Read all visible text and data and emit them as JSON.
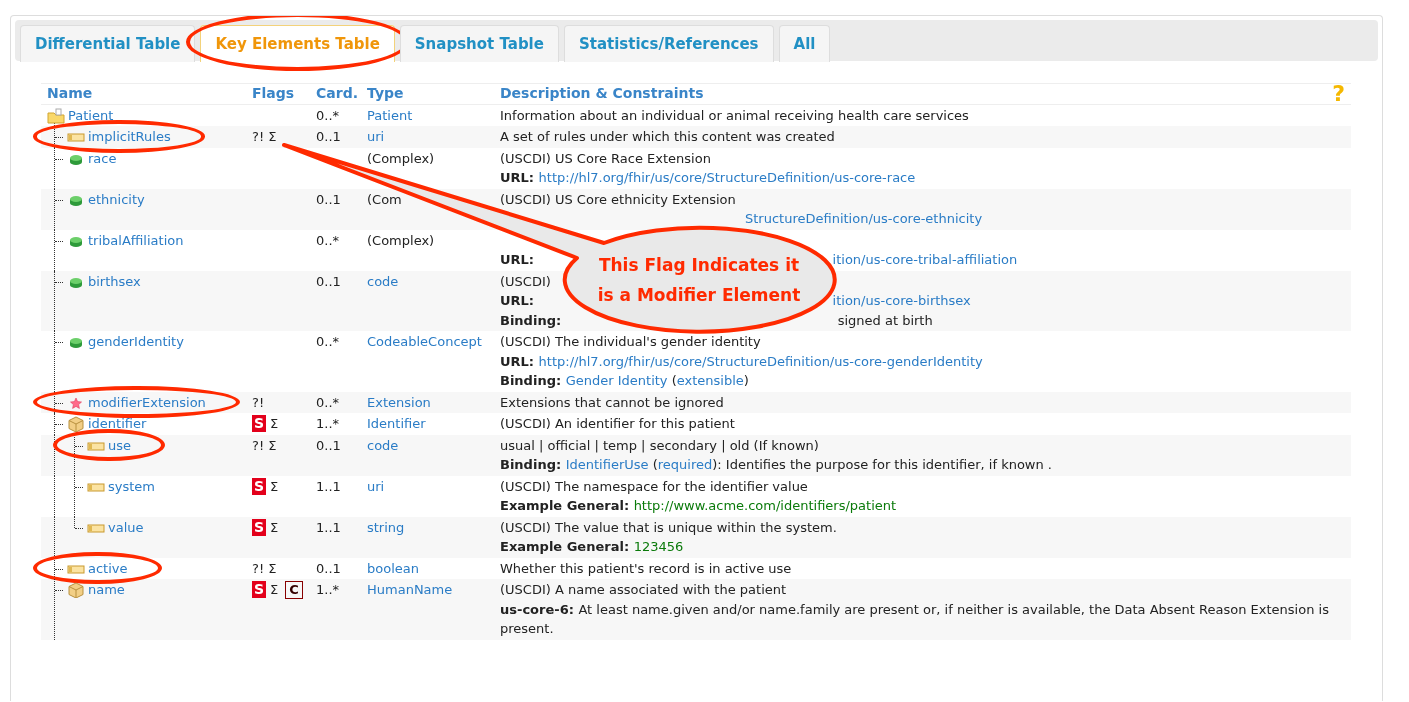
{
  "tabs": [
    {
      "label": "Differential Table",
      "selected": false,
      "circled": false
    },
    {
      "label": "Key Elements Table",
      "selected": true,
      "circled": true
    },
    {
      "label": "Snapshot Table",
      "selected": false,
      "circled": false
    },
    {
      "label": "Statistics/References",
      "selected": false,
      "circled": false
    },
    {
      "label": "All",
      "selected": false,
      "circled": false
    }
  ],
  "table": {
    "columns": [
      "Name",
      "Flags",
      "Card.",
      "Type",
      "Description & Constraints"
    ],
    "help": "?",
    "tree": [
      {
        "name": "Patient",
        "kind": "resource",
        "circled": false,
        "card": "0..*",
        "type": {
          "text": "Patient",
          "kind": "link"
        },
        "description": [
          [
            {
              "kind": "text",
              "text": "Information about an individual or animal receiving health care services"
            }
          ]
        ],
        "children": [
          {
            "name": "implicitRules",
            "kind": "element",
            "circled": true,
            "card": "0..1",
            "type": {
              "text": "uri",
              "kind": "link"
            },
            "flags": [
              {
                "kind": "modifier",
                "text": "?!"
              },
              {
                "kind": "summary",
                "text": "Σ"
              }
            ],
            "description": [
              [
                {
                  "kind": "text",
                  "text": "A set of rules under which this content was created"
                }
              ]
            ]
          },
          {
            "name": "race",
            "kind": "extension",
            "circled": false,
            "type": {
              "text": "(Complex)",
              "kind": "plain"
            },
            "description": [
              [
                {
                  "kind": "text",
                  "text": "(USCDI) US Core Race Extension"
                }
              ],
              [
                {
                  "kind": "label",
                  "text": "URL: "
                },
                {
                  "kind": "link",
                  "text": "http://hl7.org/fhir/us/core/StructureDefinition/us-core-race"
                }
              ]
            ]
          },
          {
            "name": "ethnicity",
            "kind": "extension",
            "circled": false,
            "card": "0..1",
            "type": {
              "text": "(Com",
              "kind": "plain"
            },
            "description": [
              [
                {
                  "kind": "text",
                  "text": "(USCDI) US Core ethnicity Extension"
                }
              ],
              [
                {
                  "kind": "gap"
                },
                {
                  "kind": "link",
                  "text": "StructureDefinition/us-core-ethnicity"
                }
              ]
            ]
          },
          {
            "name": "tribalAffiliation",
            "kind": "extension",
            "circled": false,
            "card": "0..*",
            "type": {
              "text": "(Complex)",
              "kind": "plain"
            },
            "description": [
              [
                {
                  "kind": "gap"
                }
              ],
              [
                {
                  "kind": "label",
                  "text": "URL: "
                },
                {
                  "kind": "gap"
                },
                {
                  "kind": "link",
                  "text": "ition/us-core-tribal-affiliation"
                }
              ]
            ]
          },
          {
            "name": "birthsex",
            "kind": "extension",
            "circled": false,
            "card": "0..1",
            "type": {
              "text": "code",
              "kind": "link"
            },
            "description": [
              [
                {
                  "kind": "text",
                  "text": "(USCDI)"
                }
              ],
              [
                {
                  "kind": "label",
                  "text": "URL: "
                },
                {
                  "kind": "gap"
                },
                {
                  "kind": "link",
                  "text": "ition/us-core-birthsex"
                }
              ],
              [
                {
                  "kind": "label",
                  "text": "Binding: "
                },
                {
                  "kind": "gap"
                },
                {
                  "kind": "text",
                  "text": "signed at birth"
                }
              ]
            ]
          },
          {
            "name": "genderIdentity",
            "kind": "extension",
            "circled": false,
            "card": "0..*",
            "type": {
              "text": "CodeableConcept",
              "kind": "link"
            },
            "description": [
              [
                {
                  "kind": "text",
                  "text": "(USCDI) The individual's gender identity"
                }
              ],
              [
                {
                  "kind": "label",
                  "text": "URL: "
                },
                {
                  "kind": "link",
                  "text": "http://hl7.org/fhir/us/core/StructureDefinition/us-core-genderIdentity"
                }
              ],
              [
                {
                  "kind": "label",
                  "text": "Binding: "
                },
                {
                  "kind": "link",
                  "text": "Gender Identity"
                },
                {
                  "kind": "text",
                  "text": " ("
                },
                {
                  "kind": "link",
                  "text": "extensible"
                },
                {
                  "kind": "text",
                  "text": ")"
                }
              ]
            ]
          },
          {
            "name": "modifierExtension",
            "kind": "modifier-extension",
            "circled": true,
            "card": "0..*",
            "type": {
              "text": "Extension",
              "kind": "link"
            },
            "flags": [
              {
                "kind": "modifier",
                "text": "?!"
              }
            ],
            "description": [
              [
                {
                  "kind": "text",
                  "text": "Extensions that cannot be ignored"
                }
              ]
            ]
          },
          {
            "name": "identifier",
            "kind": "datatype",
            "circled": false,
            "card": "1..*",
            "type": {
              "text": "Identifier",
              "kind": "link"
            },
            "flags": [
              {
                "kind": "must-support",
                "text": "S"
              },
              {
                "kind": "summary",
                "text": "Σ"
              }
            ],
            "description": [
              [
                {
                  "kind": "text",
                  "text": "(USCDI) An identifier for this patient"
                }
              ]
            ],
            "children": [
              {
                "name": "use",
                "kind": "element",
                "circled": true,
                "card": "0..1",
                "type": {
                  "text": "code",
                  "kind": "link"
                },
                "flags": [
                  {
                    "kind": "modifier",
                    "text": "?!"
                  },
                  {
                    "kind": "summary",
                    "text": "Σ"
                  }
                ],
                "description": [
                  [
                    {
                      "kind": "text",
                      "text": "usual | official | temp | secondary | old (If known)"
                    }
                  ],
                  [
                    {
                      "kind": "label",
                      "text": "Binding: "
                    },
                    {
                      "kind": "link",
                      "text": "IdentifierUse"
                    },
                    {
                      "kind": "text",
                      "text": " ("
                    },
                    {
                      "kind": "link",
                      "text": "required"
                    },
                    {
                      "kind": "text",
                      "text": "): Identifies the purpose for this identifier, if known ."
                    }
                  ]
                ]
              },
              {
                "name": "system",
                "kind": "element",
                "circled": false,
                "card": "1..1",
                "type": {
                  "text": "uri",
                  "kind": "link"
                },
                "flags": [
                  {
                    "kind": "must-support",
                    "text": "S"
                  },
                  {
                    "kind": "summary",
                    "text": "Σ"
                  }
                ],
                "description": [
                  [
                    {
                      "kind": "text",
                      "text": "(USCDI) The namespace for the identifier value"
                    }
                  ],
                  [
                    {
                      "kind": "label",
                      "text": "Example General: "
                    },
                    {
                      "kind": "example",
                      "text": "http://www.acme.com/identifiers/patient"
                    }
                  ]
                ]
              },
              {
                "name": "value",
                "kind": "element",
                "circled": false,
                "card": "1..1",
                "type": {
                  "text": "string",
                  "kind": "link"
                },
                "flags": [
                  {
                    "kind": "must-support",
                    "text": "S"
                  },
                  {
                    "kind": "summary",
                    "text": "Σ"
                  }
                ],
                "description": [
                  [
                    {
                      "kind": "text",
                      "text": "(USCDI) The value that is unique within the system."
                    }
                  ],
                  [
                    {
                      "kind": "label",
                      "text": "Example General: "
                    },
                    {
                      "kind": "example",
                      "text": "123456"
                    }
                  ]
                ]
              }
            ]
          },
          {
            "name": "active",
            "kind": "element",
            "circled": true,
            "card": "0..1",
            "type": {
              "text": "boolean",
              "kind": "link"
            },
            "flags": [
              {
                "kind": "modifier",
                "text": "?!"
              },
              {
                "kind": "summary",
                "text": "Σ"
              }
            ],
            "description": [
              [
                {
                  "kind": "text",
                  "text": "Whether this patient's record is in active use"
                }
              ]
            ]
          },
          {
            "name": "name",
            "kind": "datatype",
            "circled": false,
            "card": "1..*",
            "type": {
              "text": "HumanName",
              "kind": "link"
            },
            "flags": [
              {
                "kind": "must-support",
                "text": "S"
              },
              {
                "kind": "summary",
                "text": "Σ"
              },
              {
                "kind": "constraint",
                "text": "C"
              }
            ],
            "description": [
              [
                {
                  "kind": "text",
                  "text": "(USCDI) A name associated with the patient"
                }
              ],
              [
                {
                  "kind": "label",
                  "text": "us-core-6: "
                },
                {
                  "kind": "text",
                  "text": "At least name.given and/or name.family are present or, if neither is available, the Data Absent Reason Extension is present."
                }
              ]
            ]
          }
        ]
      }
    ]
  },
  "callout": {
    "text": "This Flag Indicates it is a Modifier Element"
  }
}
